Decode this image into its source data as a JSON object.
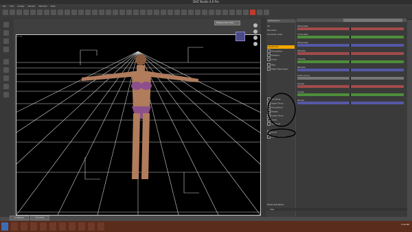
{
  "window": {
    "title": "DAZ Studio 4.6 Pro",
    "menu": [
      "File",
      "Edit",
      "Create",
      "Render",
      "Window",
      "Help"
    ]
  },
  "viewport": {
    "camera_dropdown": "Perspective View",
    "tag": "1 : 1"
  },
  "bottom_tabs": [
    "aniMate2",
    "Timeline"
  ],
  "scene": {
    "header": "Victoria 6.2",
    "rows": [
      {
        "label": "All",
        "sel": false
      },
      {
        "label": "Favorites",
        "sel": false
      },
      {
        "label": "Currently Used",
        "sel": false
      },
      {
        "label": "Transforms",
        "sel": true
      },
      {
        "label": "Translation",
        "sel": false
      },
      {
        "label": "Rotation",
        "sel": false
      },
      {
        "label": "Scale",
        "sel": false
      },
      {
        "label": "Misc",
        "sel": false
      },
      {
        "label": "Mesh Resolution",
        "sel": false
      },
      {
        "label": "Full Body",
        "sel": false
      },
      {
        "label": "Upper Torso",
        "sel": false
      },
      {
        "label": "Arms/Hand",
        "sel": false
      },
      {
        "label": "Breast",
        "sel": false
      },
      {
        "label": "Lower Torso",
        "sel": false
      },
      {
        "label": "Glute",
        "sel": false
      },
      {
        "label": "Leg/Foot",
        "sel": false
      },
      {
        "label": "Head",
        "sel": false
      },
      {
        "label": "Whole Body Ge",
        "sel": false
      }
    ],
    "show_sub_items": "Show Sub Items"
  },
  "parameters": {
    "items": [
      {
        "label": "XTranslate",
        "color": "red"
      },
      {
        "label": "YTranslate",
        "color": "green"
      },
      {
        "label": "ZTranslate",
        "color": "blue"
      },
      {
        "label": "XRotate",
        "color": "red"
      },
      {
        "label": "YRotate",
        "color": "green"
      },
      {
        "label": "ZRotate",
        "color": "blue"
      },
      {
        "label": "Scale (ours)",
        "color": "gray"
      },
      {
        "label": "XScale",
        "color": "red"
      },
      {
        "label": "YScale",
        "color": "green"
      },
      {
        "label": "ZScale",
        "color": "blue"
      }
    ],
    "bottom_label": "Tips"
  },
  "taskbar": {
    "clock": "3:44 PM"
  },
  "colors": {
    "accent": "#f2a800",
    "viewport_bg": "#000000",
    "taskbar": "#5a2c1c"
  }
}
